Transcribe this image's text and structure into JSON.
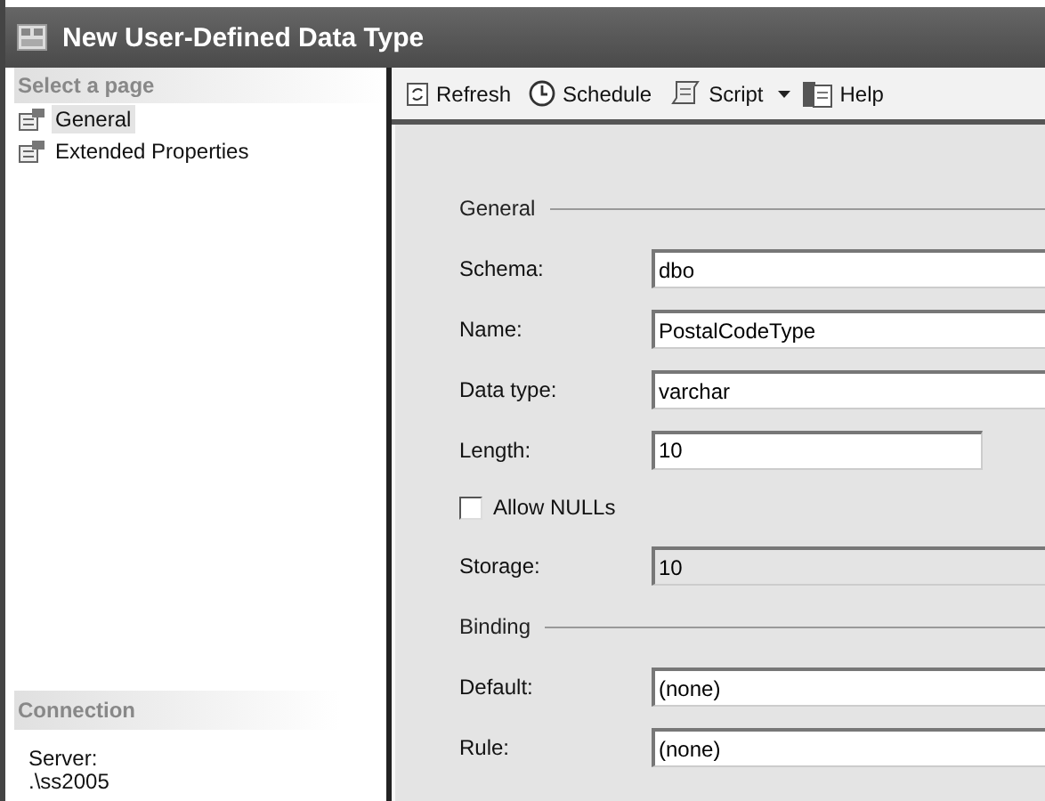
{
  "window": {
    "title": "New User-Defined Data Type"
  },
  "sidebar": {
    "heading": "Select a page",
    "items": [
      {
        "label": "General",
        "selected": true
      },
      {
        "label": "Extended Properties",
        "selected": false
      }
    ],
    "connection": {
      "heading": "Connection",
      "lines": [
        "Server:",
        ".\\ss2005"
      ]
    }
  },
  "toolbar": [
    {
      "kind": "refresh",
      "label": "Refresh"
    },
    {
      "kind": "schedule",
      "label": "Schedule"
    },
    {
      "kind": "script",
      "label": "Script",
      "dropdown": true
    },
    {
      "kind": "help",
      "label": "Help"
    }
  ],
  "form": [
    {
      "kind": "section",
      "label": "General"
    },
    {
      "kind": "field",
      "label": "Schema:",
      "value": "dbo",
      "disabled": false
    },
    {
      "kind": "field",
      "label": "Name:",
      "value": "PostalCodeType",
      "disabled": false
    },
    {
      "kind": "field",
      "label": "Data type:",
      "value": "varchar",
      "disabled": false
    },
    {
      "kind": "short-field",
      "label": "Length:",
      "value": "10",
      "disabled": false
    },
    {
      "kind": "checkbox",
      "label": "Allow NULLs",
      "checked": false
    },
    {
      "kind": "field",
      "label": "Storage:",
      "value": "10",
      "disabled": true
    },
    {
      "kind": "section",
      "label": "Binding"
    },
    {
      "kind": "field",
      "label": "Default:",
      "value": "(none)",
      "disabled": false
    },
    {
      "kind": "field",
      "label": "Rule:",
      "value": "(none)",
      "disabled": false
    }
  ]
}
